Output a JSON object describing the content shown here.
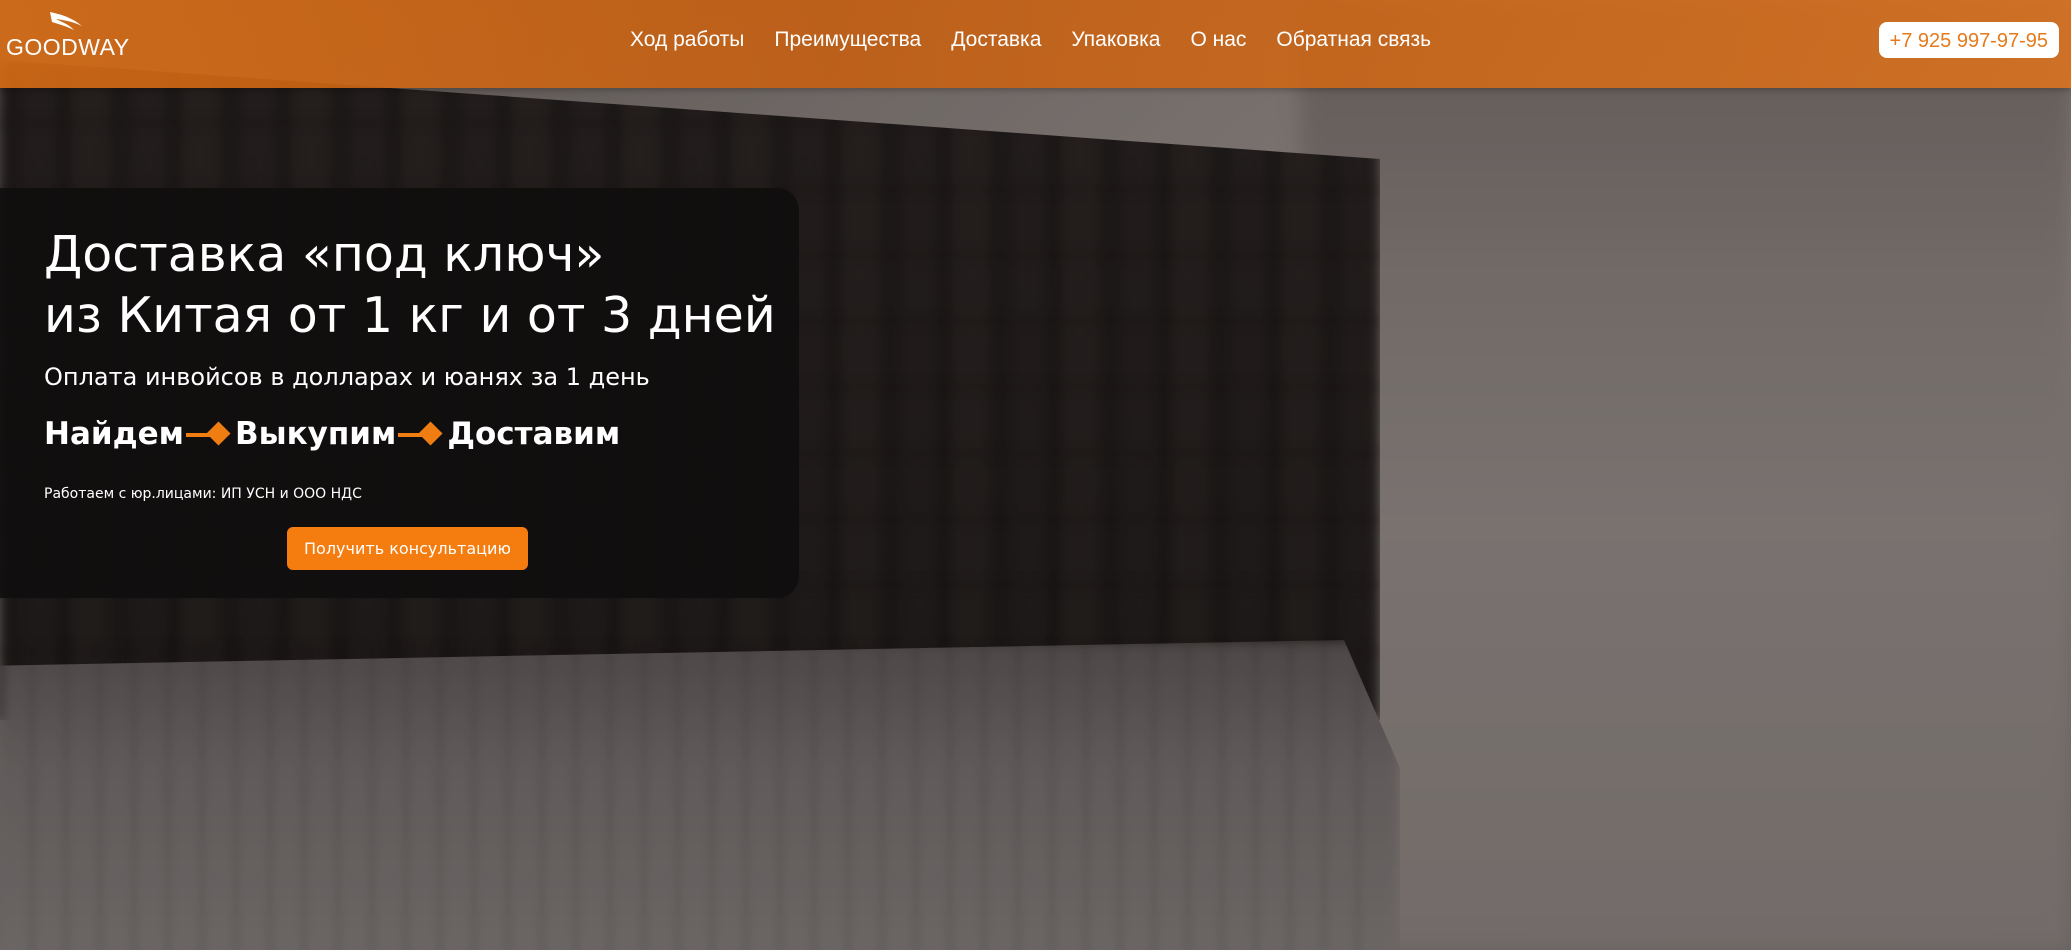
{
  "header": {
    "logo_text": "GOODWAY",
    "nav": [
      {
        "label": "Ход работы"
      },
      {
        "label": "Преимущества"
      },
      {
        "label": "Доставка"
      },
      {
        "label": "Упаковка"
      },
      {
        "label": "О нас"
      },
      {
        "label": "Обратная связь"
      }
    ],
    "phone": "+7 925 997-97-95"
  },
  "hero": {
    "title_line1": "Доставка «под ключ»",
    "title_line2": "из Китая от 1 кг и от 3 дней",
    "subtitle": "Оплата инвойсов в долларах и юанях за 1 день",
    "steps": [
      "Найдем",
      "Выкупим",
      "Доставим"
    ],
    "note": "Работаем с юр.лицами: ИП УСН и ООО НДС",
    "cta_label": "Получить консультацию"
  },
  "colors": {
    "accent": "#f57c0f",
    "header_bg": "#d26e16",
    "card_bg": "#0f0d0d",
    "text": "#ffffff"
  },
  "icons": {
    "logo": "wing-logo-icon",
    "step_separator": "arrow-diamond-icon"
  }
}
